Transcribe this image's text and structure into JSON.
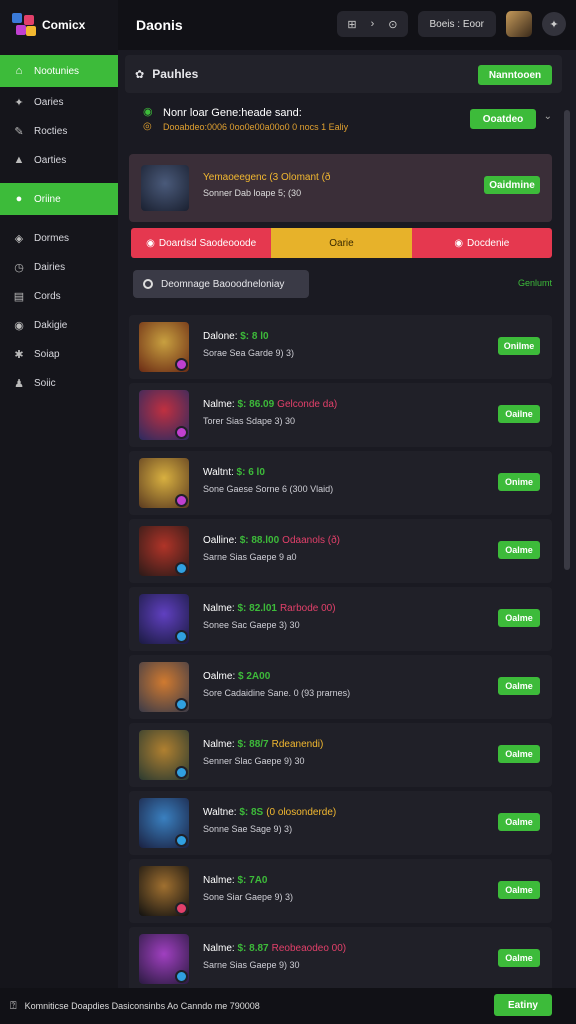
{
  "app": {
    "brand": "Comicx",
    "page_title": "Daonis"
  },
  "topbar": {
    "tools": [
      "⊞",
      "›",
      "⊙"
    ],
    "status": "Boeis : Eoor"
  },
  "sidebar": {
    "items": [
      {
        "label": "Nootunies",
        "icon": "home-icon",
        "glyph": "⌂",
        "active": true
      },
      {
        "label": "Oaries",
        "icon": "puzzle-icon",
        "glyph": "✦",
        "active": false
      },
      {
        "label": "Rocties",
        "icon": "wrench-icon",
        "glyph": "✎",
        "active": false
      },
      {
        "label": "Oarties",
        "icon": "triangle-icon",
        "glyph": "▲",
        "active": false
      },
      {
        "label": "Oriine",
        "icon": "online-icon",
        "glyph": "●",
        "active": true
      },
      {
        "label": "Dormes",
        "icon": "game-icon",
        "glyph": "◈",
        "active": false
      },
      {
        "label": "Dairies",
        "icon": "clock-icon",
        "glyph": "◷",
        "active": false
      },
      {
        "label": "Cords",
        "icon": "card-icon",
        "glyph": "▤",
        "active": false
      },
      {
        "label": "Dakigie",
        "icon": "globe-icon",
        "glyph": "◉",
        "active": false
      },
      {
        "label": "Soiap",
        "icon": "gear-icon",
        "glyph": "✱",
        "active": false
      },
      {
        "label": "Soiic",
        "icon": "user-icon",
        "glyph": "♟",
        "active": false
      }
    ]
  },
  "panel": {
    "title": "Pauhles",
    "action": "Nanntooen"
  },
  "notice": {
    "title": "Nonr loar Gene:heade sand:",
    "subtitle": "Dooabdeo:0006 0oo0e00a00o0 0 nocs 1 Ealiy",
    "action": "Ooatdeo"
  },
  "featured": {
    "title": "Yemaoeegenc (3 Olomant (ð",
    "subtitle": "Sonner Dab loape 5; (30",
    "action": "Oaidmine"
  },
  "tabs": [
    {
      "label": "Doardsd Saodeooode",
      "icon": "◉",
      "color": "red"
    },
    {
      "label": "Oarie",
      "icon": "",
      "color": "yellow"
    },
    {
      "label": "Docdenie",
      "icon": "◉",
      "color": "red"
    }
  ],
  "filter": {
    "label": "Deomnage Baooodneloniay",
    "link": "Genlumt"
  },
  "rows": [
    {
      "name": "Dalone:",
      "amount": "$: 8 l0",
      "tag": "",
      "tag_color": "#e2406a",
      "sub": "Sorae Sea Garde 9) 3)",
      "action": "Onilme",
      "thumb": [
        "#c8a040",
        "#6a2a14"
      ],
      "badge": "#c040d0"
    },
    {
      "name": "Nalme:",
      "amount": "$: 86.09",
      "tag": "Gelconde da)",
      "tag_color": "#e2406a",
      "sub": "Torer Sias Sdape 3) 30",
      "action": "Oailne",
      "thumb": [
        "#c03040",
        "#2a2a60"
      ],
      "badge": "#c040d0"
    },
    {
      "name": "Waltnt:",
      "amount": "$: 6 l0",
      "tag": "",
      "tag_color": "#e2406a",
      "sub": "Sone Gaese Sorne 6 (300 Vlaid)",
      "action": "Onime",
      "thumb": [
        "#d8b040",
        "#5a3a20"
      ],
      "badge": "#c040d0"
    },
    {
      "name": "Oalline:",
      "amount": "$: 88.l00",
      "tag": "Odaanols (ð)",
      "tag_color": "#e2406a",
      "sub": "Sarne Sias Gaepe 9 a0",
      "action": "Oalme",
      "thumb": [
        "#b03428",
        "#2a1a18"
      ],
      "badge": "#30a0e0"
    },
    {
      "name": "Nalme:",
      "amount": "$: 82.l01",
      "tag": "Rarbode 00)",
      "tag_color": "#e2406a",
      "sub": "Sonee Sac Gaepe 3) 30",
      "action": "Oalme",
      "thumb": [
        "#6040c0",
        "#1a1a40"
      ],
      "badge": "#30a0e0"
    },
    {
      "name": "Oalme:",
      "amount": "$ 2A00",
      "tag": "",
      "tag_color": "#f2b830",
      "sub": "Sore Cadaidine Sane. 0 (93 prarnes)",
      "action": "Oalme",
      "thumb": [
        "#d07a30",
        "#3a3a48"
      ],
      "badge": "#30a0e0"
    },
    {
      "name": "Nalme:",
      "amount": "$: 88/7",
      "tag": "Rdeanendi)",
      "tag_color": "#f2b830",
      "sub": "Senner Slac Gaepe 9) 30",
      "action": "Oalme",
      "thumb": [
        "#b08030",
        "#2a3a30"
      ],
      "badge": "#30a0e0"
    },
    {
      "name": "Waltne:",
      "amount": "$: 8S",
      "tag": "(0 olosonderde)",
      "tag_color": "#f2b830",
      "sub": "Sonne Sae Sage 9) 3)",
      "action": "Oalme",
      "thumb": [
        "#3a80c0",
        "#1a2040"
      ],
      "badge": "#30a0e0"
    },
    {
      "name": "Nalme:",
      "amount": "$: 7A0",
      "tag": "",
      "tag_color": "#f2b830",
      "sub": "Sone Siar Gaepe 9) 3)",
      "action": "Oalme",
      "thumb": [
        "#a07030",
        "#101010"
      ],
      "badge": "#e2406a"
    },
    {
      "name": "Nalme:",
      "amount": "$: 8.87",
      "tag": "Reobeaodeo 00)",
      "tag_color": "#e2406a",
      "sub": "Sarne Sias Gaepe 9) 30",
      "action": "Oalme",
      "thumb": [
        "#a040c0",
        "#2a1a40"
      ],
      "badge": "#30a0e0"
    }
  ],
  "footer": {
    "text": "Komniticse Doapdies Dasiconsinbs Ao Canndo me 790008",
    "action": "Eatiny"
  }
}
